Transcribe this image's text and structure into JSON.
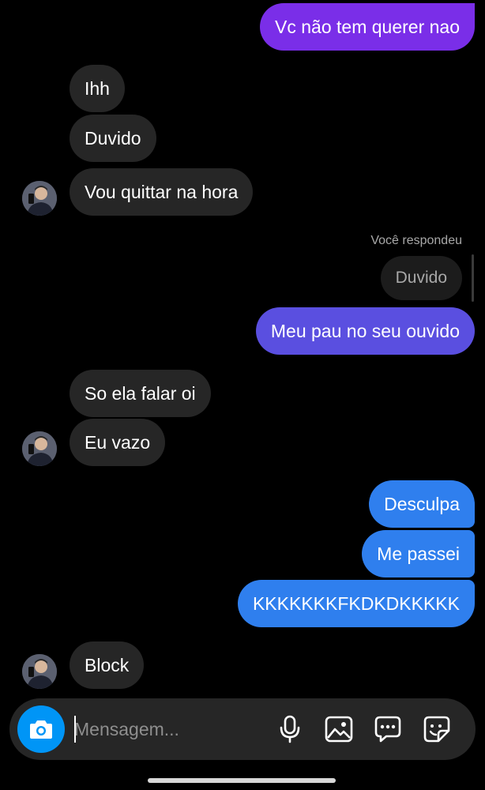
{
  "colors": {
    "sent_top": "#7a2ee8",
    "sent_purple": "#7e2fe6",
    "sent_indigo": "#5a4fe0",
    "sent_blue": "#2f7fee",
    "received": "#262626",
    "accent": "#0095f6"
  },
  "thread": {
    "messages": [
      {
        "side": "sent",
        "text": "Vc não tem querer nao"
      },
      {
        "side": "received",
        "text": "Ihh"
      },
      {
        "side": "received",
        "text": "Duvido"
      },
      {
        "side": "received",
        "text": "Vou quittar na hora"
      },
      {
        "side": "sent",
        "reply_label": "Você respondeu",
        "quoted": "Duvido",
        "text": "Meu pau no seu ouvido"
      },
      {
        "side": "received",
        "text": "So ela falar oi"
      },
      {
        "side": "received",
        "text": "Eu vazo"
      },
      {
        "side": "sent",
        "text": "Desculpa"
      },
      {
        "side": "sent",
        "text": "Me passei"
      },
      {
        "side": "sent",
        "text": "KKKKKKKFKDKDKKKKK"
      },
      {
        "side": "received",
        "text": "Block"
      }
    ]
  },
  "composer": {
    "placeholder": "Mensagem...",
    "icons": [
      "camera-icon",
      "microphone-icon",
      "gallery-icon",
      "chat-bubble-icon",
      "sticker-icon"
    ]
  }
}
